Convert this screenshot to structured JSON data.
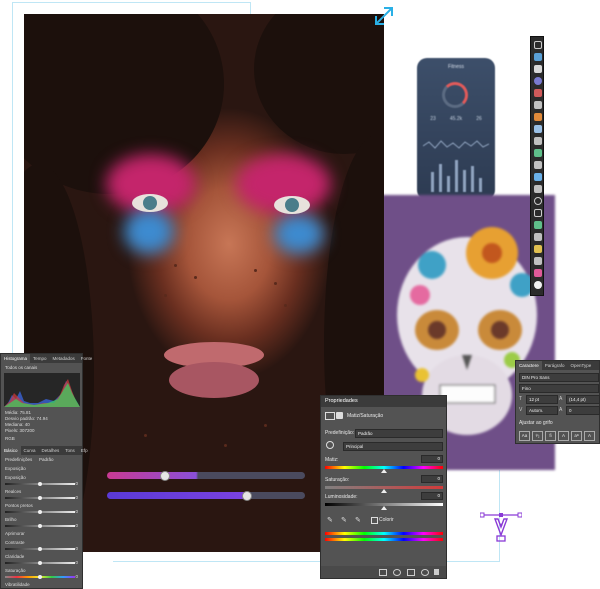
{
  "photo": {
    "alt": "",
    "icon": "expand-arrows-icon"
  },
  "phone": {
    "title": "Fitness",
    "stats": [
      "23",
      "45.2k",
      "26"
    ]
  },
  "histogram_panel": {
    "tabs": [
      "Histograma",
      "Tempo",
      "Metadados",
      "Fonte"
    ],
    "channel_label": "Todos os canais",
    "info_rows": [
      "Média: 75.81",
      "Desvio padrão: 74.94",
      "Mediana: 40",
      "Pixels: 307200"
    ],
    "mid_label": "RGB",
    "tabs2": [
      "Básico",
      "Curva",
      "Detalhes",
      "Tons",
      "Efp"
    ],
    "preset_labels": [
      "Predefinições",
      "Padrão"
    ],
    "section_exposure": "Exposição",
    "rows": [
      {
        "label": "Exposição",
        "value": "0"
      },
      {
        "label": "Realces",
        "value": "0"
      },
      {
        "label": "Pontos pretos",
        "value": "0"
      },
      {
        "label": "Brilho",
        "value": "0"
      }
    ],
    "section_enhance": "Aprimorar",
    "rows2": [
      {
        "label": "Contraste",
        "value": "0"
      },
      {
        "label": "Claridade",
        "value": "0"
      },
      {
        "label": "Saturação",
        "value": "0"
      },
      {
        "label": "Vibratilidade",
        "value": "0"
      }
    ]
  },
  "props_panel": {
    "title": "Propriedades",
    "layer_name": "Matiz/Saturação",
    "preset_label": "Predefinição:",
    "preset_value": "Padrão",
    "channel_value": "Principal",
    "hue_label": "Matiz:",
    "hue_value": "0",
    "sat_label": "Saturação:",
    "sat_value": "0",
    "light_label": "Luminosidade:",
    "light_value": "0",
    "colorize_label": "Colorir"
  },
  "char_panel": {
    "tabs": [
      "Caractere",
      "Parágrafo",
      "OpenType"
    ],
    "font": "DIN Pro Sans",
    "style": "Fino",
    "size": "12 pt",
    "leading": "(14,4 pt)",
    "kerning": "Autom.",
    "tracking": "0",
    "baseline": "0 pt",
    "adjust_label": "Ajustar ao grifo"
  },
  "sliders": {
    "top_fraction": 0.29,
    "bottom_fraction": 0.7
  },
  "colors": {
    "accent": "#8a3ad6",
    "guide": "#bfe6f5",
    "panel": "#535353"
  }
}
